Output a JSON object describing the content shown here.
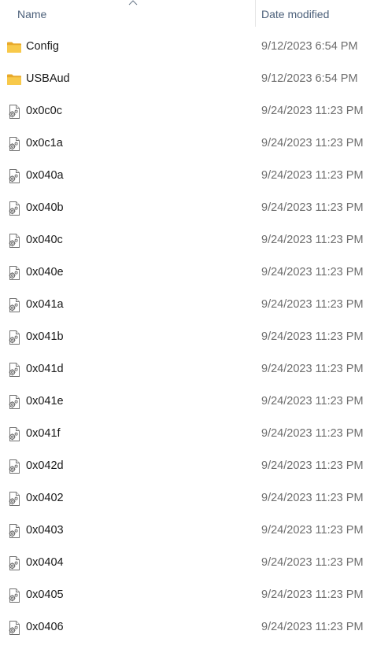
{
  "header": {
    "name_label": "Name",
    "date_label": "Date modified",
    "sort_icon": "chevron-up-icon"
  },
  "colors": {
    "folder": "#f6c342",
    "header_text": "#4c607a",
    "date_text": "#6d6d6d"
  },
  "items": [
    {
      "name": "Config",
      "date": "9/12/2023 6:54 PM",
      "type": "folder"
    },
    {
      "name": "USBAud",
      "date": "9/12/2023 6:54 PM",
      "type": "folder"
    },
    {
      "name": "0x0c0c",
      "date": "9/24/2023 11:23 PM",
      "type": "settings-file"
    },
    {
      "name": "0x0c1a",
      "date": "9/24/2023 11:23 PM",
      "type": "settings-file"
    },
    {
      "name": "0x040a",
      "date": "9/24/2023 11:23 PM",
      "type": "settings-file"
    },
    {
      "name": "0x040b",
      "date": "9/24/2023 11:23 PM",
      "type": "settings-file"
    },
    {
      "name": "0x040c",
      "date": "9/24/2023 11:23 PM",
      "type": "settings-file"
    },
    {
      "name": "0x040e",
      "date": "9/24/2023 11:23 PM",
      "type": "settings-file"
    },
    {
      "name": "0x041a",
      "date": "9/24/2023 11:23 PM",
      "type": "settings-file"
    },
    {
      "name": "0x041b",
      "date": "9/24/2023 11:23 PM",
      "type": "settings-file"
    },
    {
      "name": "0x041d",
      "date": "9/24/2023 11:23 PM",
      "type": "settings-file"
    },
    {
      "name": "0x041e",
      "date": "9/24/2023 11:23 PM",
      "type": "settings-file"
    },
    {
      "name": "0x041f",
      "date": "9/24/2023 11:23 PM",
      "type": "settings-file"
    },
    {
      "name": "0x042d",
      "date": "9/24/2023 11:23 PM",
      "type": "settings-file"
    },
    {
      "name": "0x0402",
      "date": "9/24/2023 11:23 PM",
      "type": "settings-file"
    },
    {
      "name": "0x0403",
      "date": "9/24/2023 11:23 PM",
      "type": "settings-file"
    },
    {
      "name": "0x0404",
      "date": "9/24/2023 11:23 PM",
      "type": "settings-file"
    },
    {
      "name": "0x0405",
      "date": "9/24/2023 11:23 PM",
      "type": "settings-file"
    },
    {
      "name": "0x0406",
      "date": "9/24/2023 11:23 PM",
      "type": "settings-file"
    }
  ]
}
